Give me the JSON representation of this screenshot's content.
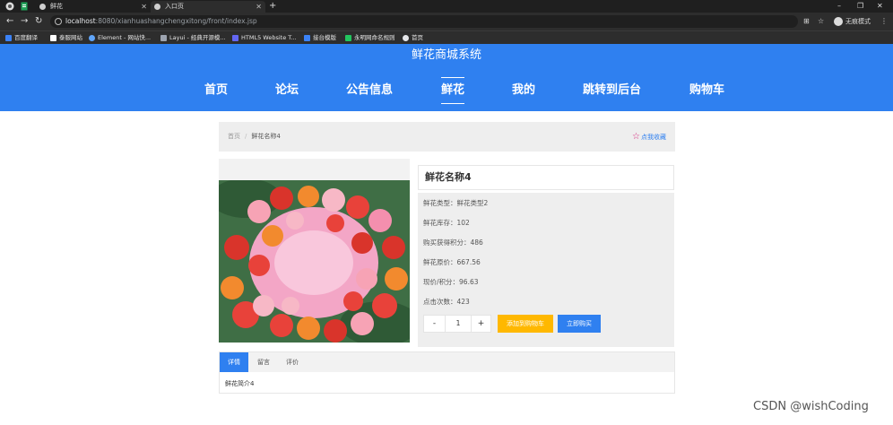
{
  "browser": {
    "tabs": [
      {
        "title": "鲜花"
      },
      {
        "title": "入口页"
      }
    ],
    "new_tab": "+",
    "window_controls": {
      "minimize": "–",
      "restore": "❐",
      "close": "✕"
    },
    "url_host": "localhost",
    "url_rest": ":8080/xianhuashangchengxitong/front/index.jsp",
    "incognito_label": "无痕模式",
    "bookmarks": [
      {
        "label": "百度翻译",
        "color": "#3b82f6"
      },
      {
        "label": "泰服网站",
        "color": "#ffffff"
      },
      {
        "label": "Element - 网站快...",
        "color": "#60a5fa"
      },
      {
        "label": "Layui - 经典开源模...",
        "color": "#9ca3af"
      },
      {
        "label": "HTML5 Website T...",
        "color": "#6366f1"
      },
      {
        "label": "接台模版",
        "color": "#3b82f6"
      },
      {
        "label": "永明网命名规则",
        "color": "#22c55e"
      },
      {
        "label": "首页",
        "color": "#e5e7eb"
      }
    ]
  },
  "site": {
    "title": "鲜花商城系统",
    "nav": [
      "首页",
      "论坛",
      "公告信息",
      "鲜花",
      "我的",
      "跳转到后台",
      "购物车"
    ],
    "active_nav": "鲜花"
  },
  "breadcrumb": {
    "home": "首页",
    "separator": "/",
    "current": "鲜花名称4"
  },
  "favorite": {
    "star": "☆",
    "label": "点我收藏"
  },
  "product": {
    "name": "鲜花名称4",
    "details": [
      {
        "label": "鲜花类型：",
        "value": "鲜花类型2"
      },
      {
        "label": "鲜花库存：",
        "value": "102"
      },
      {
        "label": "购买获得积分：",
        "value": "486"
      },
      {
        "label": "鲜花原价：",
        "value": "667.56"
      },
      {
        "label": "现价/积分：",
        "value": "96.63"
      },
      {
        "label": "点击次数：",
        "value": "423"
      }
    ],
    "quantity": {
      "minus": "-",
      "value": "1",
      "plus": "+"
    },
    "add_to_cart": "添加到购物车",
    "buy_now": "立即购买"
  },
  "tabs": {
    "items": [
      "详情",
      "留言",
      "评价"
    ],
    "active": "详情",
    "content": "鲜花简介4"
  },
  "watermark": "CSDN @wishCoding",
  "colors": {
    "header": "#2f80f0",
    "buy_button": "#2f80f0",
    "cart_button": "#ffb800",
    "favorite_star": "#d4237a"
  }
}
